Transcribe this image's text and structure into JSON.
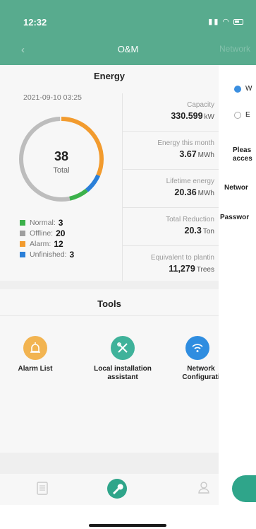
{
  "status_bar": {
    "time": "12:32"
  },
  "nav": {
    "back": "‹",
    "title": "O&M",
    "right_label": "Network"
  },
  "energy": {
    "title": "Energy",
    "date": "2021-09-10 03:25",
    "total_number": "38",
    "total_label": "Total",
    "legend": [
      {
        "label": "Normal:",
        "value": "3",
        "color": "#3cb14b"
      },
      {
        "label": "Offline:",
        "value": "20",
        "color": "#9e9e9e"
      },
      {
        "label": "Alarm:",
        "value": "12",
        "color": "#f29b2e"
      },
      {
        "label": "Unfinished:",
        "value": "3",
        "color": "#2a7fd8"
      }
    ],
    "stats": [
      {
        "label": "Capacity",
        "value": "330.599",
        "unit": "kW"
      },
      {
        "label": "Energy this month",
        "value": "3.67",
        "unit": "MWh"
      },
      {
        "label": "Lifetime energy",
        "value": "20.36",
        "unit": "MWh"
      },
      {
        "label": "Total Reduction",
        "value": "20.3",
        "unit": "Ton"
      },
      {
        "label": "Equivalent to plantin",
        "value": "11,279",
        "unit": "Trees"
      }
    ]
  },
  "tools": {
    "title": "Tools",
    "items": [
      {
        "label": "Alarm List",
        "color": "#f2b451"
      },
      {
        "label": "Local installation assistant",
        "color": "#3fb29a"
      },
      {
        "label": "Network Configurati",
        "color": "#2f8de0"
      }
    ]
  },
  "tabbar": {
    "items": [
      "report-icon",
      "wrench-icon",
      "user-icon"
    ]
  },
  "side": {
    "option_1": "W",
    "option_2": "E",
    "hint_line_1": "Pleas",
    "hint_line_2": "acces",
    "network_label": "Networ",
    "password_label": "Passwor"
  },
  "colors": {
    "header": "#58ab8e",
    "accent": "#2fa58a"
  }
}
